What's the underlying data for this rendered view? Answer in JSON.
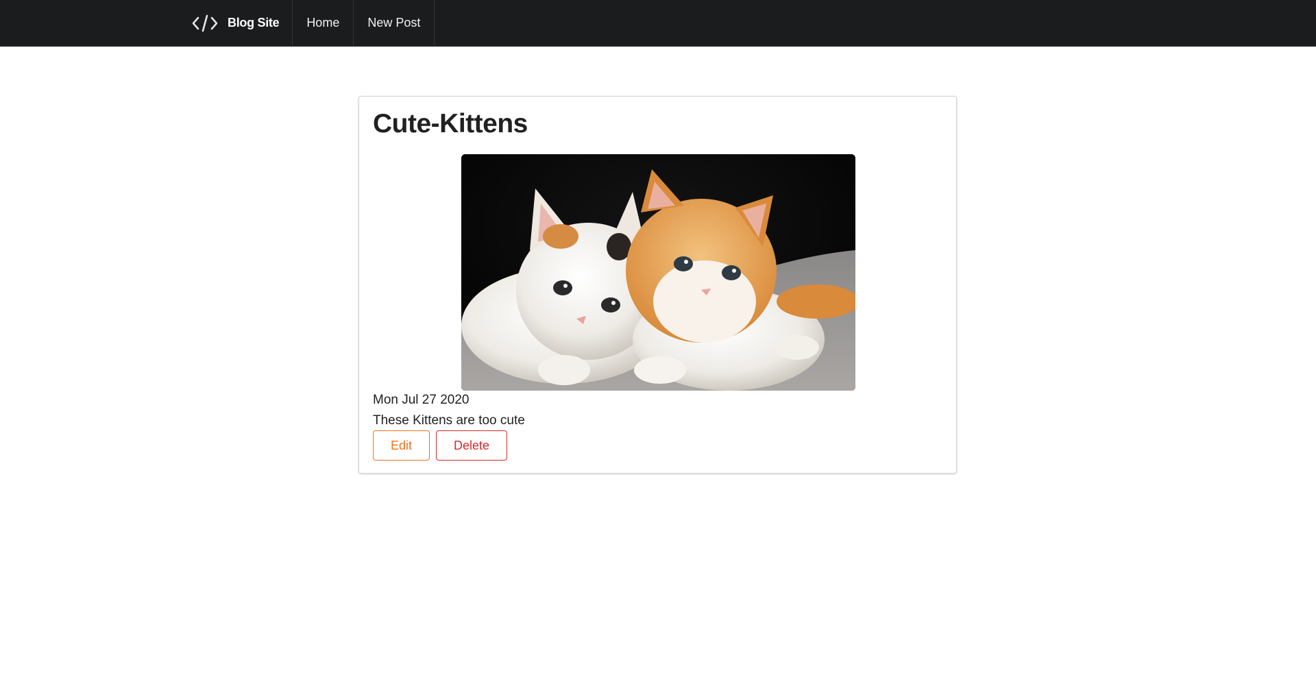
{
  "navbar": {
    "brand_icon": "code-icon",
    "brand_label": "Blog Site",
    "items": [
      {
        "label": "Home"
      },
      {
        "label": "New Post"
      }
    ]
  },
  "post": {
    "title": "Cute-Kittens",
    "image_subject": "two-kittens-photo",
    "date": "Mon Jul 27 2020",
    "body": "These Kittens are too cute",
    "edit_label": "Edit",
    "delete_label": "Delete"
  },
  "colors": {
    "navbar_bg": "#1b1c1d",
    "edit_accent": "#f2711c",
    "delete_accent": "#db2828"
  }
}
